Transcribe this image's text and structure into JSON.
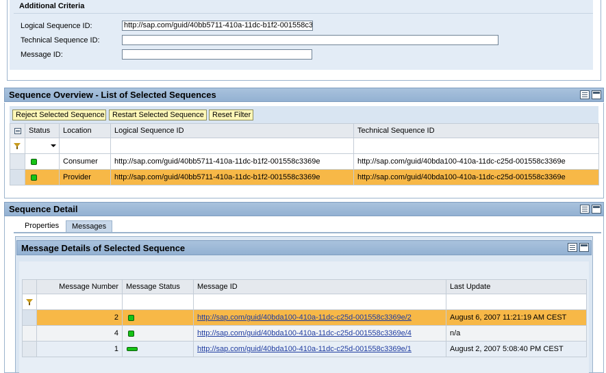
{
  "criteria": {
    "title": "Additional Criteria",
    "logical_label": "Logical Sequence ID:",
    "logical_value": "http://sap.com/guid/40bb5711-410a-11dc-b1f2-001558c3",
    "technical_label": "Technical Sequence ID:",
    "technical_value": "",
    "message_label": "Message ID:",
    "message_value": ""
  },
  "overview": {
    "title": "Sequence Overview - List of Selected Sequences",
    "buttons": {
      "reject": "Reject Selected Sequence",
      "restart": "Restart Selected Sequence",
      "reset": "Reset Filter"
    },
    "columns": [
      "Status",
      "Location",
      "Logical Sequence ID",
      "Technical Sequence ID"
    ],
    "rows": [
      {
        "status": "green",
        "location": "Consumer",
        "logical": "http://sap.com/guid/40bb5711-410a-11dc-b1f2-001558c3369e",
        "technical": "http://sap.com/guid/40bda100-410a-11dc-c25d-001558c3369e",
        "selected": false
      },
      {
        "status": "green",
        "location": "Provider",
        "logical": "http://sap.com/guid/40bb5711-410a-11dc-b1f2-001558c3369e",
        "technical": "http://sap.com/guid/40bda100-410a-11dc-c25d-001558c3369e",
        "selected": true
      }
    ]
  },
  "detail": {
    "title": "Sequence Detail",
    "tabs": [
      "Properties",
      "Messages"
    ],
    "active_tab": "Messages",
    "messages_panel": {
      "title": "Message Details of Selected Sequence",
      "columns": [
        "Message Number",
        "Message Status",
        "Message ID",
        "Last Update"
      ],
      "rows": [
        {
          "number": "2",
          "status_icon": "green-square",
          "id": "http://sap.com/guid/40bda100-410a-11dc-c25d-001558c3369e/2",
          "last_update": "August 6, 2007 11:21:19 AM CEST",
          "selected": true
        },
        {
          "number": "4",
          "status_icon": "green-square",
          "id": "http://sap.com/guid/40bda100-410a-11dc-c25d-001558c3369e/4",
          "last_update": "n/a",
          "selected": false
        },
        {
          "number": "1",
          "status_icon": "green-bar",
          "id": "http://sap.com/guid/40bda100-410a-11dc-c25d-001558c3369e/1",
          "last_update": "August 2, 2007 5:08:40 PM CEST",
          "selected": false
        }
      ]
    }
  },
  "colors": {
    "header_blue": "#a9c2dd",
    "selected_row": "#f7b847",
    "button_yellow": "#fef7b8",
    "status_green": "#16c316",
    "link_blue": "#1f3ca0"
  }
}
